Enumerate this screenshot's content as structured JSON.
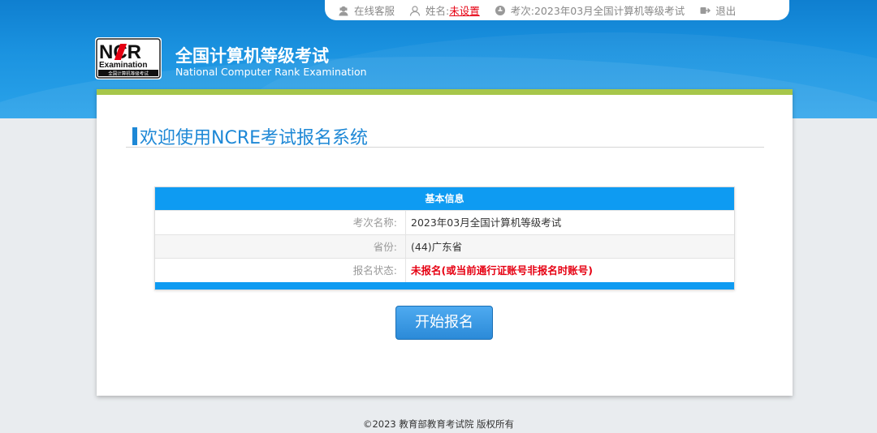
{
  "topbar": {
    "online_service": "在线客服",
    "name_label": "姓名:",
    "name_value": "未设置",
    "exam_label": "考次:",
    "exam_value": "2023年03月全国计算机等级考试",
    "logout": "退出"
  },
  "header": {
    "logo_mark": "NCR",
    "logo_examination": "Examination",
    "logo_caption": "全国计算机等级考试",
    "title": "全国计算机等级考试",
    "subtitle": "National Computer Rank Examination"
  },
  "main": {
    "welcome": "欢迎使用NCRE考试报名系统",
    "info_title": "基本信息",
    "rows": [
      {
        "label": "考次名称:",
        "value": "2023年03月全国计算机等级考试"
      },
      {
        "label": "省份:",
        "value": "(44)广东省"
      },
      {
        "label": "报名状态:",
        "value": "未报名(或当前通行证账号非报名时账号)"
      }
    ],
    "start_button": "开始报名"
  },
  "footer": {
    "copyright": "©2023 教育部教育考试院 版权所有"
  },
  "colors": {
    "brand_blue": "#0e9bf2",
    "accent_green": "#a6c64a",
    "alert_red": "#e60012"
  }
}
